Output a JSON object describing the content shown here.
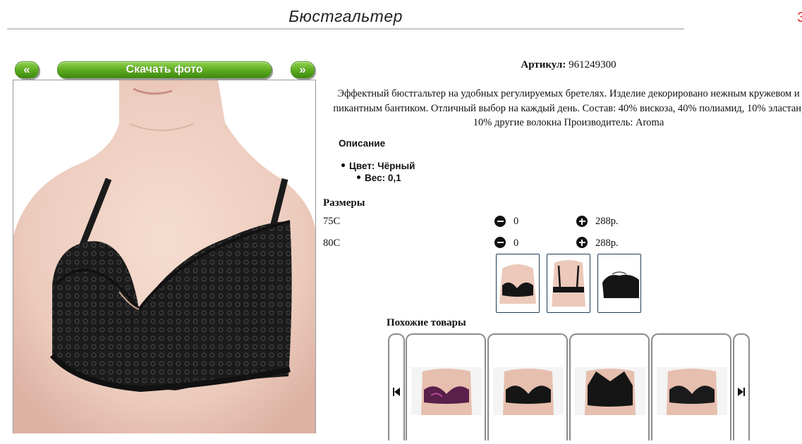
{
  "header": {
    "title": "Бюстгальтер",
    "edge_mark": "З"
  },
  "nav": {
    "prev_label": "«",
    "download_label": "Скачать фото",
    "next_label": "»"
  },
  "product": {
    "sku_label": "Артикул:",
    "sku_value": "961249300",
    "description": "Эффектный бюстгальтер на удобных регулируемых бретелях. Изделие декорировано нежным кружевом и пикантным бантиком. Отличный выбор на каждый день. Состав: 40% вискоза, 40% полиамид, 10% эластан, 10% другие волокна Производитель: Aroma",
    "description_heading": "Описание",
    "attributes": [
      {
        "label": "Цвет: Чёрный"
      },
      {
        "label": "Вес: 0,1"
      }
    ]
  },
  "sizes": {
    "heading": "Размеры",
    "rows": [
      {
        "size": "75C",
        "qty": "0",
        "price": "288р."
      },
      {
        "size": "80C",
        "qty": "0",
        "price": "288р."
      }
    ]
  },
  "similar": {
    "heading": "Похожие товары"
  },
  "colors": {
    "button_green": "#5fae22",
    "accent_red": "#d22222",
    "thumb_border": "#1d3d5a"
  },
  "icons": [
    "minus-circle-icon",
    "plus-circle-icon",
    "skip-back-icon",
    "skip-forward-icon"
  ]
}
